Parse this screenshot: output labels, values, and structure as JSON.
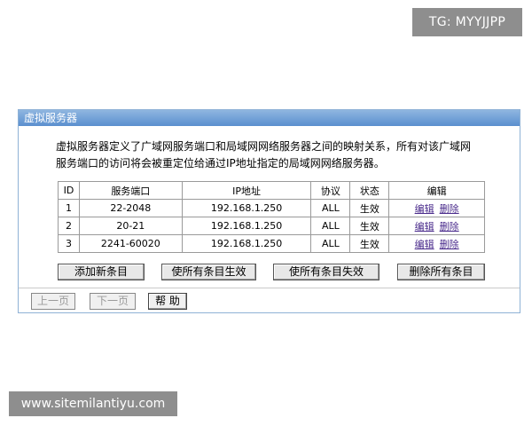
{
  "watermarks": {
    "top": "TG: MYYJJPP",
    "bottom": "www.sitemilantiyu.com"
  },
  "panel": {
    "title": "虚拟服务器",
    "description_line1": "虚拟服务器定义了广域网服务端口和局域网网络服务器之间的映射关系，所有对该广域网",
    "description_line2": "服务端口的访问将会被重定位给通过IP地址指定的局域网网络服务器。"
  },
  "table": {
    "headers": [
      "ID",
      "服务端口",
      "IP地址",
      "协议",
      "状态",
      "编辑"
    ],
    "rows": [
      {
        "id": "1",
        "port": "22-2048",
        "ip": "192.168.1.250",
        "protocol": "ALL",
        "status": "生效",
        "edit": "编辑",
        "delete": "删除"
      },
      {
        "id": "2",
        "port": "20-21",
        "ip": "192.168.1.250",
        "protocol": "ALL",
        "status": "生效",
        "edit": "编辑",
        "delete": "删除"
      },
      {
        "id": "3",
        "port": "2241-60020",
        "ip": "192.168.1.250",
        "protocol": "ALL",
        "status": "生效",
        "edit": "编辑",
        "delete": "删除"
      }
    ]
  },
  "actions": {
    "add_new": "添加新条目",
    "enable_all": "使所有条目生效",
    "disable_all": "使所有条目失效",
    "delete_all": "删除所有条目"
  },
  "nav": {
    "prev": "上一页",
    "next": "下一页",
    "help": "帮 助"
  }
}
